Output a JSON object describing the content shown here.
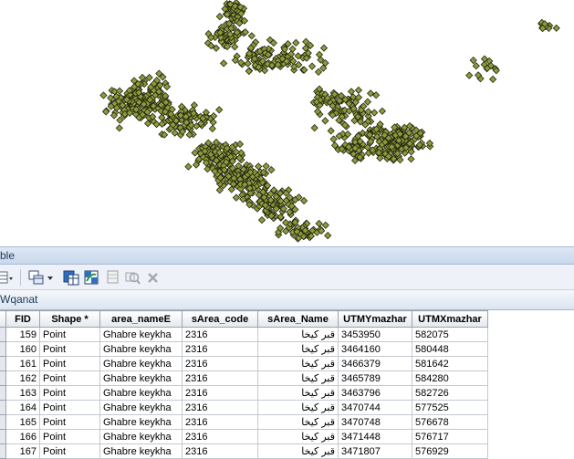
{
  "panel": {
    "title": "ble"
  },
  "toolbar": {
    "icons": [
      "table-options-icon",
      "related-tables-icon",
      "select-by-attributes-icon",
      "switch-selection-icon",
      "clear-selection-icon",
      "zoom-to-selected-icon",
      "delete-selected-icon"
    ]
  },
  "layer_tab": {
    "label": "Wqanat"
  },
  "map": {
    "point_fill": "#8f9a3c",
    "point_stroke": "#222611"
  },
  "table": {
    "columns": [
      "",
      "FID",
      "Shape *",
      "area_nameE",
      "sArea_code",
      "sArea_Name",
      "UTMYmazhar",
      "UTMXmazhar"
    ],
    "rows": [
      {
        "fid": "159",
        "shape": "Point",
        "area": "Ghabre keykha",
        "code": "2316",
        "name": "قبر کیخا",
        "utmy": "3453950",
        "utmx": "582075"
      },
      {
        "fid": "160",
        "shape": "Point",
        "area": "Ghabre keykha",
        "code": "2316",
        "name": "قبر کیخا",
        "utmy": "3464160",
        "utmx": "580448"
      },
      {
        "fid": "161",
        "shape": "Point",
        "area": "Ghabre keykha",
        "code": "2316",
        "name": "قبر کیخا",
        "utmy": "3466379",
        "utmx": "581642"
      },
      {
        "fid": "162",
        "shape": "Point",
        "area": "Ghabre keykha",
        "code": "2316",
        "name": "قبر کیخا",
        "utmy": "3465789",
        "utmx": "584280"
      },
      {
        "fid": "163",
        "shape": "Point",
        "area": "Ghabre keykha",
        "code": "2316",
        "name": "قبر کیخا",
        "utmy": "3463796",
        "utmx": "582726"
      },
      {
        "fid": "164",
        "shape": "Point",
        "area": "Ghabre keykha",
        "code": "2316",
        "name": "قبر کیخا",
        "utmy": "3470744",
        "utmx": "577525"
      },
      {
        "fid": "165",
        "shape": "Point",
        "area": "Ghabre keykha",
        "code": "2316",
        "name": "قبر کیخا",
        "utmy": "3470748",
        "utmx": "576678"
      },
      {
        "fid": "166",
        "shape": "Point",
        "area": "Ghabre keykha",
        "code": "2316",
        "name": "قبر کیخا",
        "utmy": "3471448",
        "utmx": "576717"
      },
      {
        "fid": "167",
        "shape": "Point",
        "area": "Ghabre keykha",
        "code": "2316",
        "name": "قبر کیخا",
        "utmy": "3471807",
        "utmx": "576929"
      }
    ]
  }
}
